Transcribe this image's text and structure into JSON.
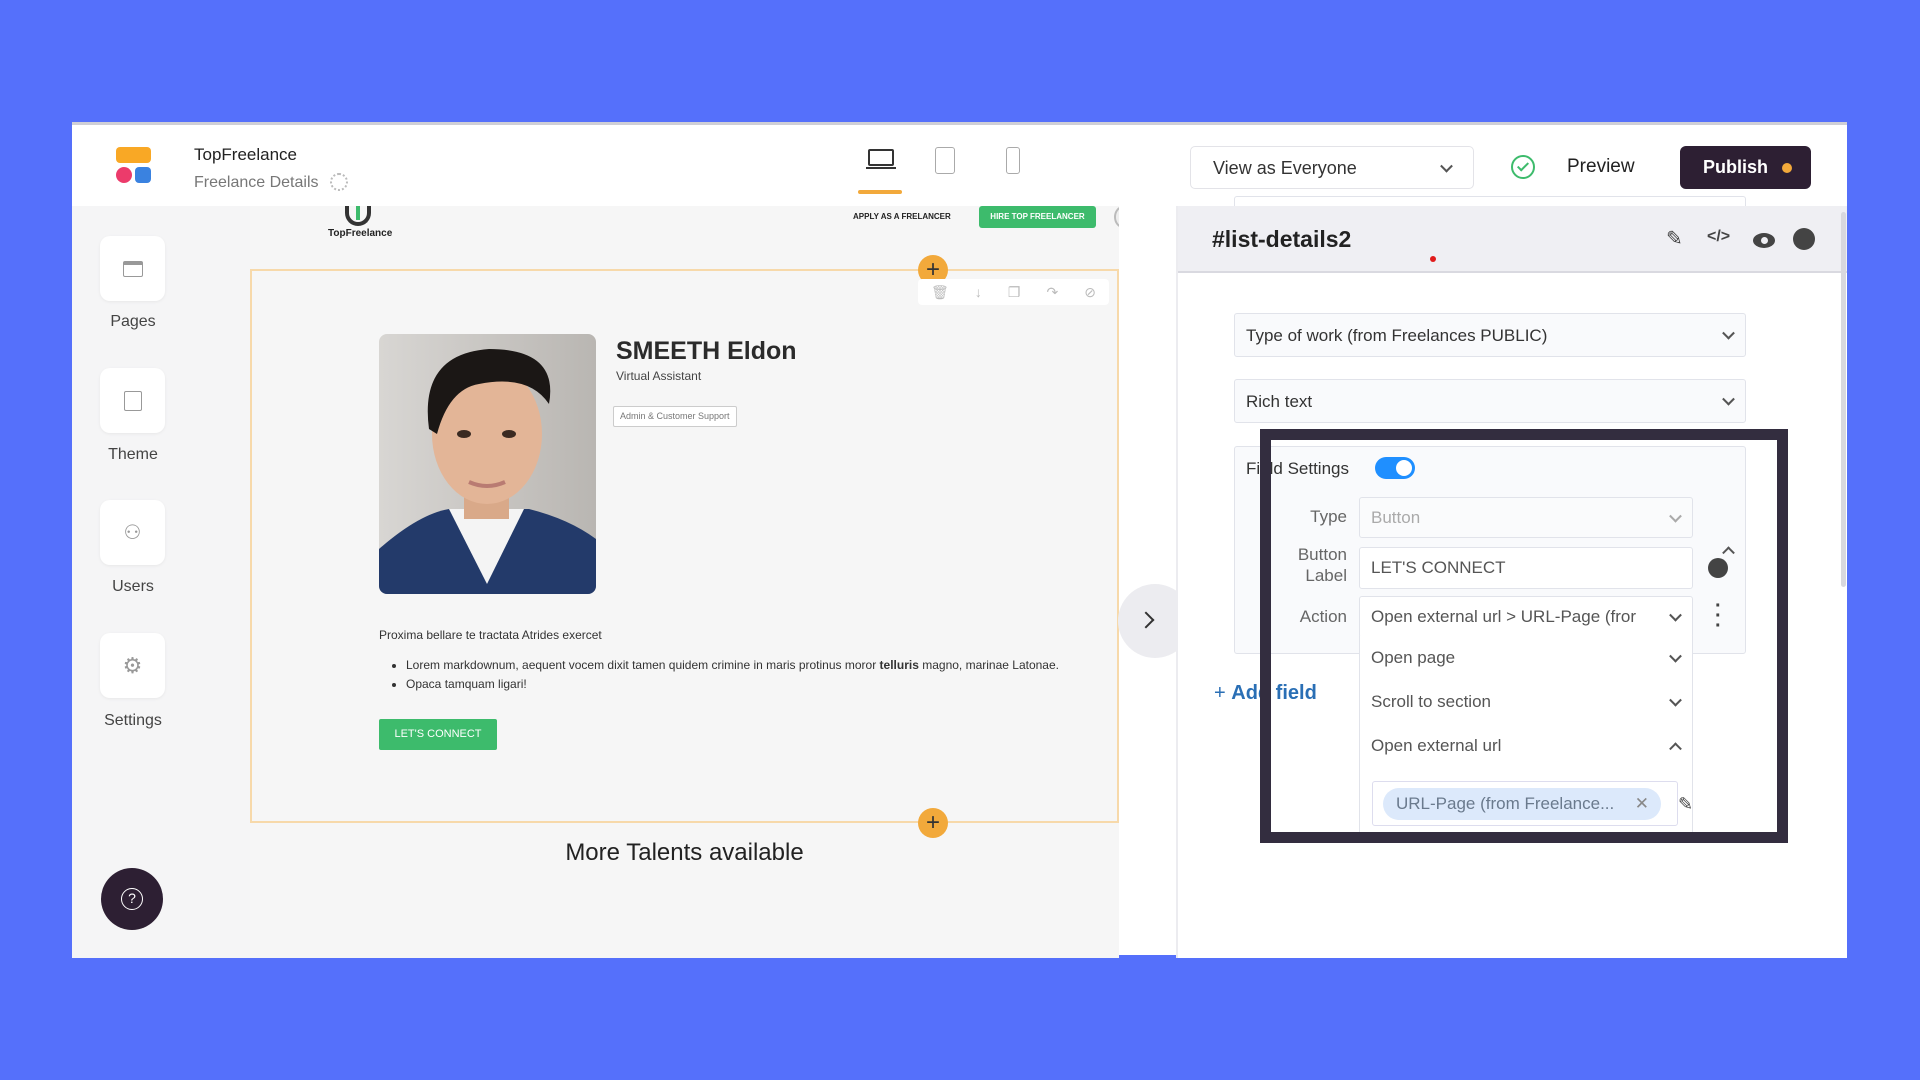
{
  "header": {
    "app_name": "TopFreelance",
    "page_name": "Freelance Details",
    "view_as": "View as Everyone",
    "preview_label": "Preview",
    "publish_label": "Publish",
    "devices": [
      "desktop",
      "tablet",
      "mobile"
    ],
    "active_device": "desktop"
  },
  "sidebar": {
    "items": [
      {
        "label": "Pages",
        "icon": "pages-icon"
      },
      {
        "label": "Theme",
        "icon": "theme-icon"
      },
      {
        "label": "Users",
        "icon": "users-icon"
      },
      {
        "label": "Settings",
        "icon": "gear-icon"
      }
    ],
    "help_icon": "question-icon"
  },
  "site": {
    "logo_text": "TopFreelance",
    "nav_apply": "APPLY AS A FRELANCER",
    "nav_hire": "HIRE TOP FREELANCER"
  },
  "profile": {
    "name": "SMEETH Eldon",
    "role": "Virtual Assistant",
    "tag": "Admin & Customer Support",
    "paragraph": "Proxima bellare te tractata Atrides exercet",
    "bullet1_pre": "Lorem markdownum, aequent vocem dixit tamen quidem crimine in maris protinus moror ",
    "bullet1_bold": "telluris",
    "bullet1_post": " magno, marinae Latonae.",
    "bullet2": "Opaca tamquam ligari!",
    "button": "LET'S CONNECT"
  },
  "more_title": "More Talents available",
  "panel": {
    "title": "#list-details2",
    "field1": "Type of work (from Freelances PUBLIC)",
    "field2": "Rich text",
    "settings_label": "Field Settings",
    "settings_enabled": true,
    "type_label": "Type",
    "type_value": "Button",
    "button_label_label1": "Button",
    "button_label_label2": "Label",
    "button_label_value": "LET'S CONNECT",
    "action_label": "Action",
    "action_value": "Open external url > URL-Page (fror",
    "options": [
      "Open page",
      "Scroll to section",
      "Open external url"
    ],
    "url_chip": "URL-Page (from Freelance...",
    "add_field": "Add field"
  },
  "colors": {
    "background": "#5570fb",
    "publish": "#2d1f33",
    "accent_orange": "#f2a93b",
    "green": "#3dbb6c",
    "toggle": "#1f8fff",
    "link_blue": "#2a6fb5",
    "highlight_frame": "#332d3f"
  }
}
